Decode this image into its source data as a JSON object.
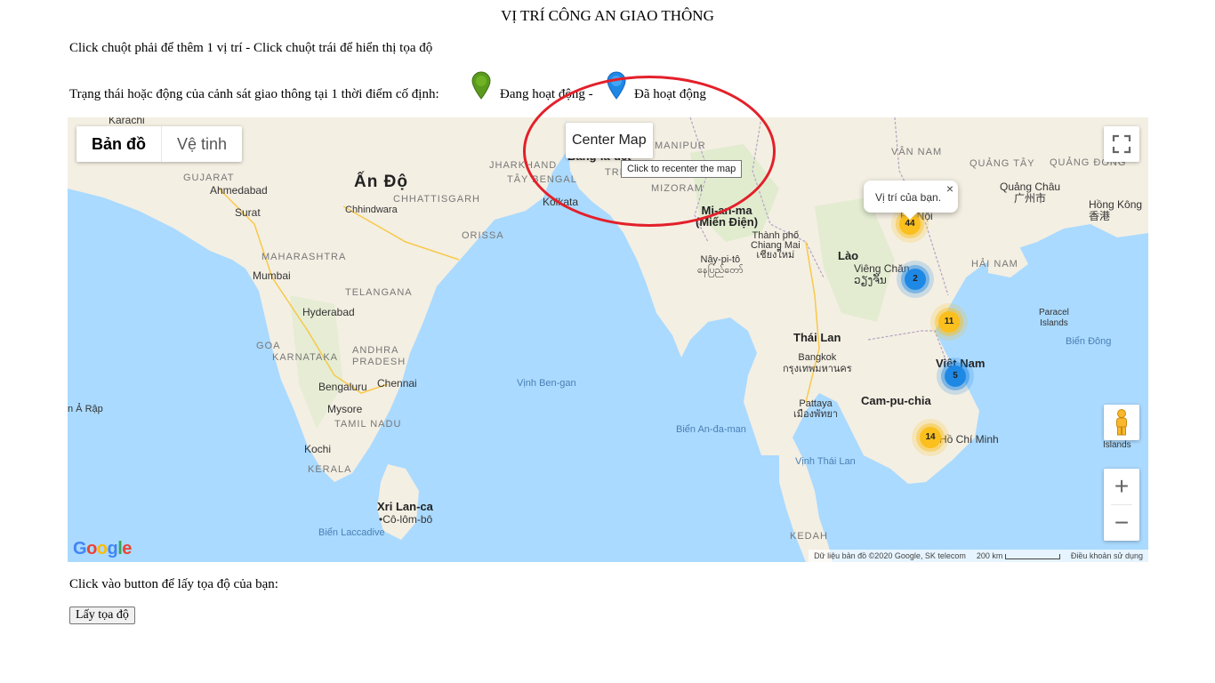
{
  "page": {
    "title": "VỊ TRÍ CÔNG AN GIAO THÔNG",
    "instruction": "Click chuột phải để thêm 1 vị trí - Click chuột trái để hiển thị tọa độ",
    "status_text": "Trạng thái hoặc động của cảnh sát giao thông tại 1 thời điểm cố định:",
    "status_active": "Đang hoạt động -",
    "status_done": "Đã hoạt động",
    "get_coords_text": "Click vào button để lấy tọa độ của bạn:",
    "get_coords_button": "Lấy tọa độ"
  },
  "legend": {
    "active_color": "#5a9a1e",
    "done_color": "#1e88e5"
  },
  "map": {
    "type_buttons": {
      "map": "Bản đồ",
      "satellite": "Vệ tinh"
    },
    "center_button": "Center Map",
    "center_tooltip": "Click to recenter the map",
    "info_window": "Vị trí của bạn.",
    "info_close": "×",
    "zoom_in": "+",
    "zoom_out": "−",
    "google_logo": "Google",
    "attribution": "Dữ liệu bản đồ ©2020 Google, SK telecom",
    "scale": "200 km",
    "terms": "Điều khoản sử dụng",
    "clusters": [
      {
        "count": "44",
        "color": "yellow"
      },
      {
        "count": "2",
        "color": "blue"
      },
      {
        "count": "11",
        "color": "yellow"
      },
      {
        "count": "5",
        "color": "blue"
      },
      {
        "count": "14",
        "color": "yellow"
      }
    ],
    "labels": {
      "karachi": "Karachi",
      "gujarat": "GUJARAT",
      "ahmedabad": "Ahmedabad",
      "surat": "Surat",
      "mumbai": "Mumbai",
      "maharashtra": "MAHARASHTRA",
      "telangana": "TELANGANA",
      "hyderabad": "Hyderabad",
      "goa": "GOA",
      "karnataka": "KARNATAKA",
      "andhra": "ANDHRA\nPRADESH",
      "bengaluru": "Bengaluru",
      "chennai": "Chennai",
      "mysore": "Mysore",
      "tamilnadu": "TAMIL NADU",
      "kochi": "Kochi",
      "kerala": "KERALA",
      "india": "Ấn Độ",
      "chhattisgarh": "CHHATTISGARH",
      "chhindwara": "Chhindwara",
      "jharkhand": "JHARKHAND",
      "orissa": "ORISSA",
      "kolkata": "Kolkata",
      "taybengal": "TÂY BENGAL",
      "bangladesh": "Bang-la-đét",
      "tri": "TRI",
      "manipur": "MANIPUR",
      "mizoram": "MIZORAM",
      "myanmar": "Mi-an-ma\n(Miến Điện)",
      "naypyitaw": "Nây-pi-tô\nနေပြည်တော်",
      "chiangmai": "Thành phố\nChiang Mai\nเชียงใหม่",
      "laos": "Lào",
      "vientiane": "Viêng Chăn\nວຽງຈັນ",
      "thailand": "Thái Lan",
      "bangkok": "Bangkok\nกรุงเทพมหานคร",
      "pattaya": "Pattaya\nเมืองพัทยา",
      "cambodia": "Cam-pu-chia",
      "vietnam": "Việt Nam",
      "hochiminh": "Hồ Chí Minh",
      "hanoi": "Hà Nội",
      "vannam": "VÂN NAM",
      "quangtay": "QUẢNG TÂY",
      "quangdong": "QUẢNG ĐÔNG",
      "quangchau": "Quảng Châu\n广州市",
      "hongkong": "Hồng Kông\n香港",
      "haiNam": "HẢI NAM",
      "paracel": "Paracel\nIslands",
      "biendong": "Biển Đông",
      "islands": "Islands",
      "benGan": "Vịnh Ben-gan",
      "andaman": "Biển An-đa-man",
      "thaigulf": "Vịnh Thái Lan",
      "laccadive": "Biển Laccadive",
      "srilanka": "Xri Lan-ca",
      "colombo": "•Cô-lôm-bô",
      "arap": "n Ả Rập",
      "kedah": "KEDAH"
    }
  }
}
